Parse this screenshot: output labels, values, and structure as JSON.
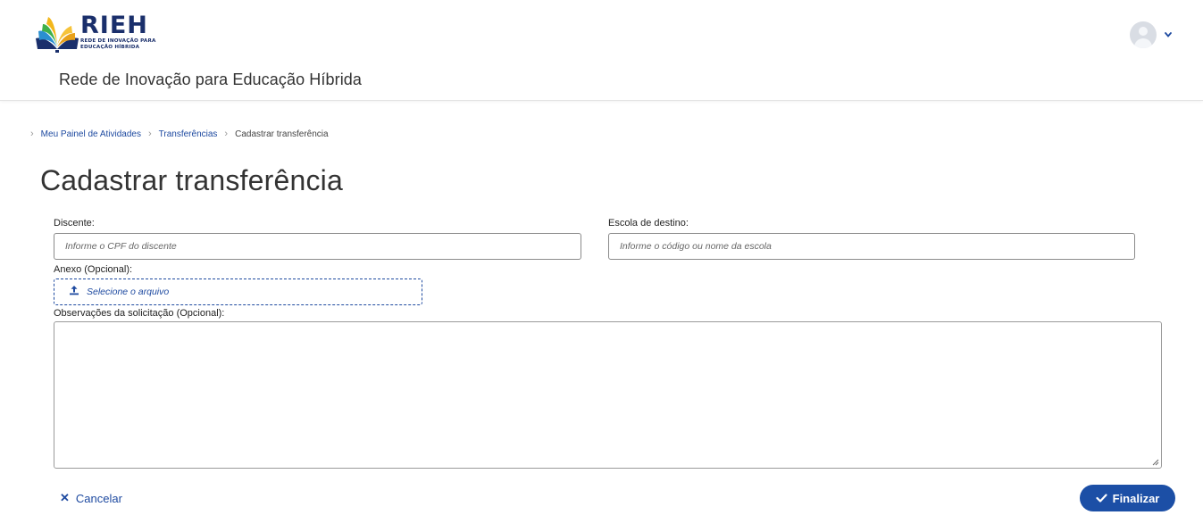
{
  "header": {
    "logo": {
      "title": "RIEH",
      "subtitle_line1": "REDE DE INOVAÇÃO PARA",
      "subtitle_line2": "EDUCAÇÃO HÍBRIDA"
    },
    "site_name": "Rede de Inovação para Educação Híbrida",
    "user_menu": {
      "avatar_icon": "user-avatar-icon",
      "caret_icon": "chevron-down-icon"
    }
  },
  "breadcrumb": {
    "items": [
      "Meu Painel de Atividades",
      "Transferências"
    ],
    "current": "Cadastrar transferência"
  },
  "page": {
    "title": "Cadastrar transferência"
  },
  "form": {
    "discente": {
      "label": "Discente:",
      "placeholder": "Informe o CPF do discente",
      "value": ""
    },
    "escola": {
      "label": "Escola de destino:",
      "placeholder": "Informe o código ou nome da escola",
      "value": ""
    },
    "anexo": {
      "label": "Anexo (Opcional):",
      "button_label": "Selecione o arquivo",
      "icon": "upload-icon"
    },
    "observacoes": {
      "label": "Observações da solicitação (Opcional):",
      "value": ""
    }
  },
  "actions": {
    "cancel_label": "Cancelar",
    "finish_label": "Finalizar"
  },
  "colors": {
    "brand_blue": "#1c4fa6",
    "link_blue": "#1e4aa0",
    "logo_navy": "#1a2f6b"
  }
}
